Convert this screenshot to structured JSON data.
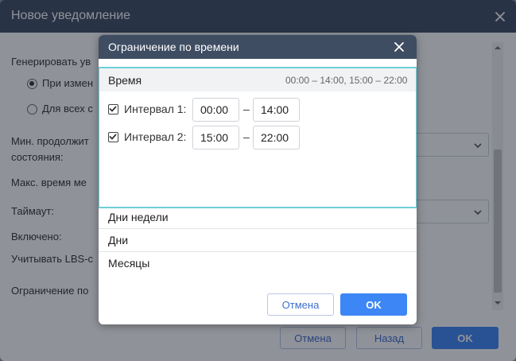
{
  "outer_dialog": {
    "title": "Новое уведомление",
    "labels": {
      "generate": "Генерировать ув",
      "radio_1": "При измен",
      "radio_2": "Для всех с",
      "min_duration_1": "Мин. продолжит",
      "min_duration_2": "состояния:",
      "max_time": "Макс. время ме",
      "timeout": "Таймаут:",
      "enabled": "Включено:",
      "lbs": "Учитывать LBS-с",
      "time_limit": "Ограничение по"
    },
    "buttons": {
      "cancel": "Отмена",
      "back": "Назад",
      "ok": "OK"
    }
  },
  "modal": {
    "title": "Ограничение по времени",
    "time_section": {
      "label": "Время",
      "summary": "00:00 – 14:00, 15:00 – 22:00",
      "intervals": [
        {
          "label": "Интервал 1:",
          "checked": true,
          "from": "00:00",
          "to": "14:00"
        },
        {
          "label": "Интервал 2:",
          "checked": true,
          "from": "15:00",
          "to": "22:00"
        }
      ],
      "separator": "–"
    },
    "sections": {
      "weekdays": "Дни недели",
      "days": "Дни",
      "months": "Месяцы"
    },
    "buttons": {
      "cancel": "Отмена",
      "ok": "OK"
    }
  },
  "colors": {
    "header_bg": "#3f4d63",
    "accent_blue": "#3d86f5",
    "focus_cyan": "#6fcfd8"
  }
}
